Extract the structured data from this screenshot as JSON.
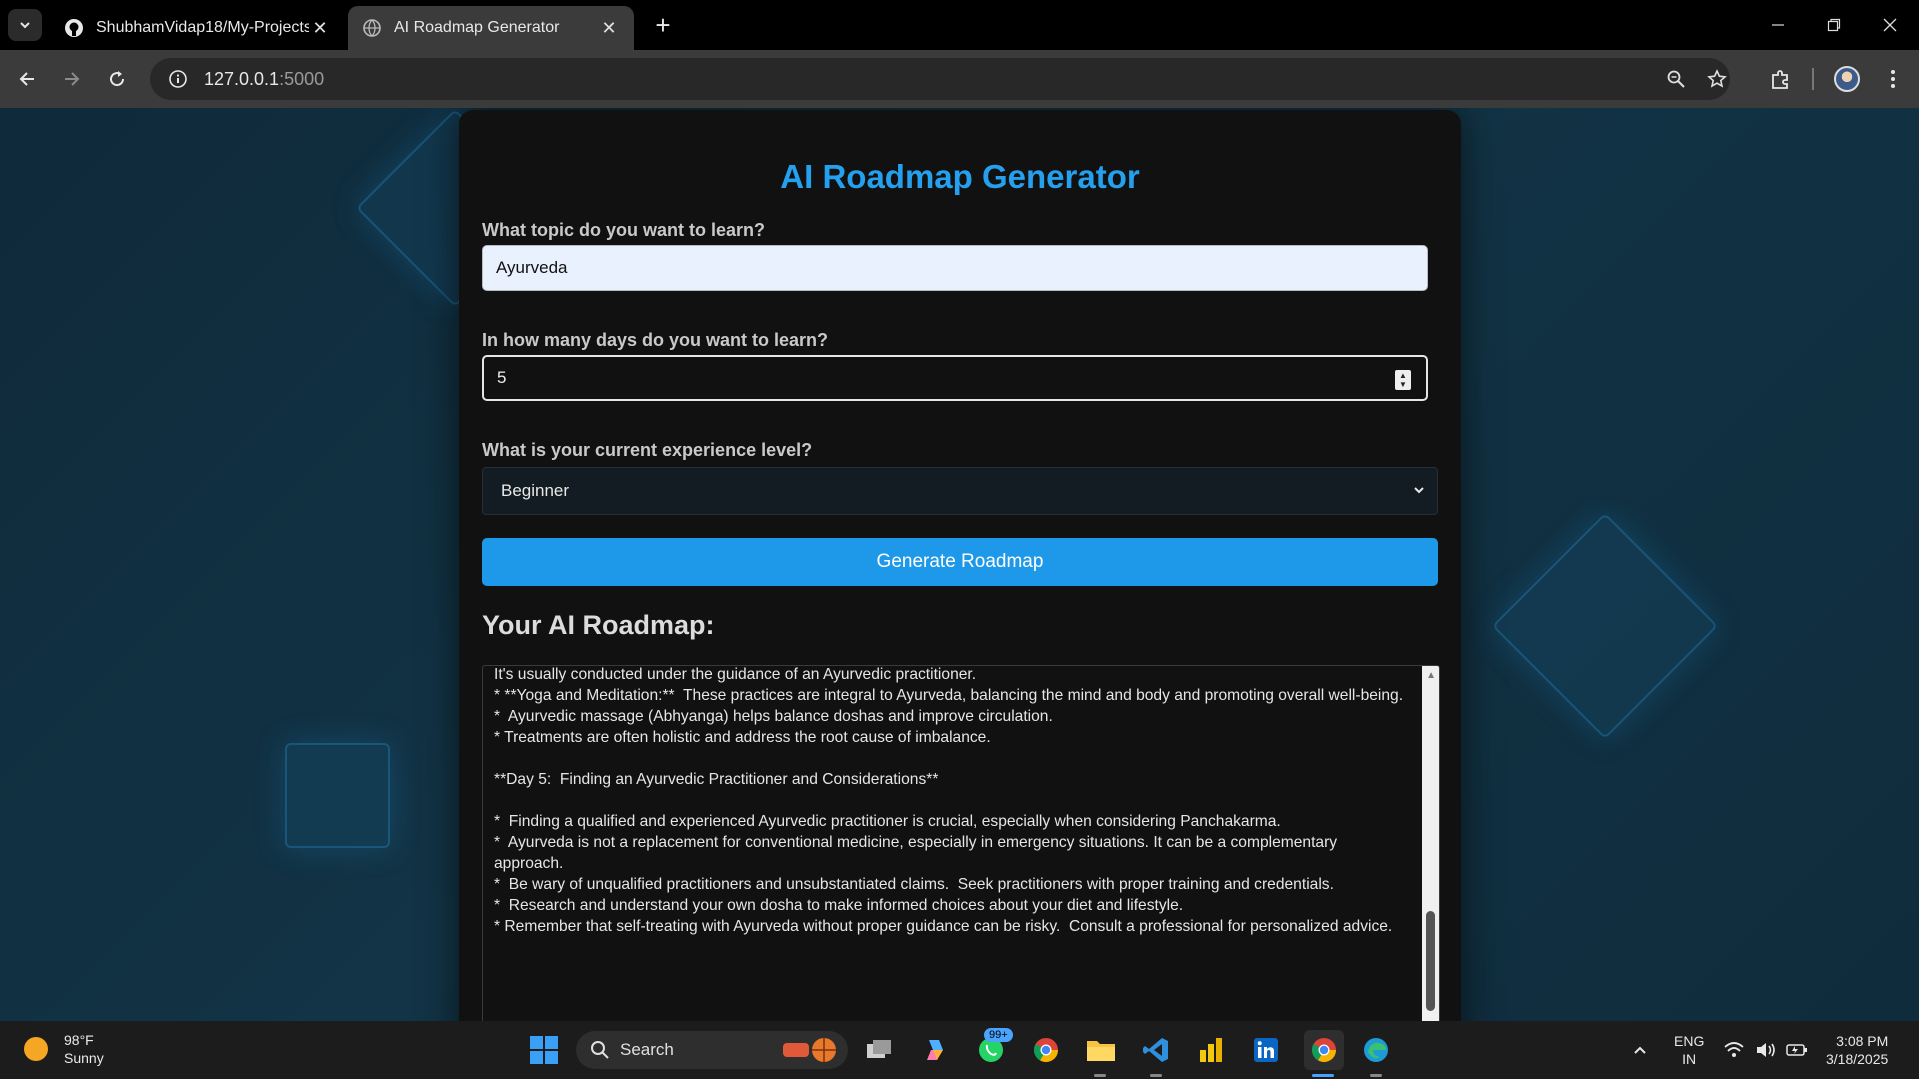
{
  "browser": {
    "tabs": [
      {
        "title": "ShubhamVidap18/My-Projects:",
        "icon": "github-icon"
      },
      {
        "title": "AI Roadmap Generator",
        "icon": "globe-icon",
        "active": true
      }
    ],
    "url_host": "127.0.0.1",
    "url_port": ":5000"
  },
  "app": {
    "heading": "AI Roadmap Generator",
    "topic_label": "What topic do you want to learn?",
    "topic_value": "Ayurveda",
    "days_label": "In how many days do you want to learn?",
    "days_value": "5",
    "level_label": "What is your current experience level?",
    "level_value": "Beginner",
    "generate_label": "Generate Roadmap",
    "roadmap_title": "Your AI Roadmap:",
    "roadmap_text": "It's usually conducted under the guidance of an Ayurvedic practitioner.\n* **Yoga and Meditation:**  These practices are integral to Ayurveda, balancing the mind and body and promoting overall well-being.\n*  Ayurvedic massage (Abhyanga) helps balance doshas and improve circulation.\n* Treatments are often holistic and address the root cause of imbalance.\n\n**Day 5:  Finding an Ayurvedic Practitioner and Considerations**\n\n*  Finding a qualified and experienced Ayurvedic practitioner is crucial, especially when considering Panchakarma.\n*  Ayurveda is not a replacement for conventional medicine, especially in emergency situations. It can be a complementary approach.\n*  Be wary of unqualified practitioners and unsubstantiated claims.  Seek practitioners with proper training and credentials.\n*  Research and understand your own dosha to make informed choices about your diet and lifestyle.\n* Remember that self-treating with Ayurveda without proper guidance can be risky.  Consult a professional for personalized advice."
  },
  "taskbar": {
    "temperature": "98°F",
    "condition": "Sunny",
    "search_label": "Search",
    "whatsapp_badge": "99+",
    "lang_top": "ENG",
    "lang_bottom": "IN",
    "time": "3:08 PM",
    "date": "3/18/2025"
  },
  "colors": {
    "accent": "#1e98e8",
    "heading": "#24a0ee",
    "card_bg": "#111111",
    "page_bg": "#0f2a3a"
  }
}
